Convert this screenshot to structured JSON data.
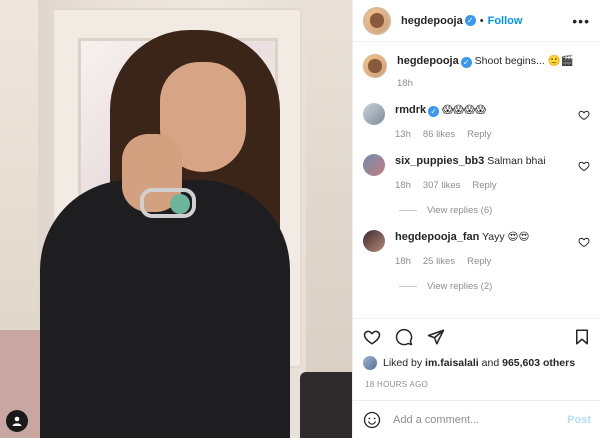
{
  "post": {
    "author": "hegdepooja",
    "follow_label": "Follow",
    "caption_author": "hegdepooja",
    "caption_text": "Shoot begins... 🙂🎬",
    "caption_time": "18h"
  },
  "comments": [
    {
      "user": "rmdrk",
      "verified": true,
      "text": "😱😱😱😱",
      "time": "13h",
      "likes": "86 likes",
      "reply": "Reply",
      "view_replies": ""
    },
    {
      "user": "six_puppies_bb3",
      "verified": false,
      "text": "Salman bhai",
      "time": "18h",
      "likes": "307 likes",
      "reply": "Reply",
      "view_replies": "View replies (6)"
    },
    {
      "user": "hegdepooja_fan",
      "verified": false,
      "text": "Yayy 😍😍",
      "time": "18h",
      "likes": "25 likes",
      "reply": "Reply",
      "view_replies": "View replies (2)"
    }
  ],
  "likes": {
    "prefix": "Liked by",
    "user": "im.faisalali",
    "joiner": "and",
    "others": "965,603 others"
  },
  "timestamp": "18 HOURS AGO",
  "add_comment": {
    "placeholder": "Add a comment...",
    "post_label": "Post"
  },
  "icons": {
    "like": "heart-icon",
    "comment": "comment-icon",
    "share": "share-icon",
    "save": "bookmark-icon",
    "more": "more-icon",
    "emoji": "emoji-icon"
  },
  "colors": {
    "accent": "#0095f6",
    "post_disabled": "#b2dffc",
    "verified": "#3897f0",
    "muted": "#8e8e8e"
  }
}
